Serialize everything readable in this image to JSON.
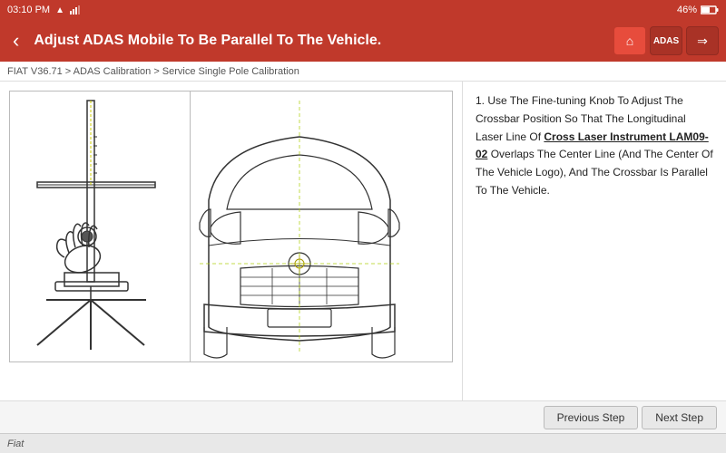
{
  "statusBar": {
    "time": "03:10 PM",
    "battery": "46%"
  },
  "header": {
    "title": "Adjust ADAS Mobile To Be Parallel To The Vehicle.",
    "backLabel": "‹"
  },
  "breadcrumb": {
    "text": "FIAT V36.71 > ADAS Calibration > Service Single Pole Calibration"
  },
  "instruction": {
    "step": "1.",
    "text1": " Use The Fine-tuning Knob To Adjust The Crossbar Position So That The Longitudinal Laser Line Of ",
    "highlight": "Cross Laser Instrument LAM09-02",
    "text2": " Overlaps The Center Line (And The Center Of The Vehicle Logo), And The Crossbar Is Parallel To The Vehicle."
  },
  "footer": {
    "previousStep": "Previous Step",
    "nextStep": "Next Step"
  },
  "brandBar": {
    "brand": "Fiat"
  },
  "icons": {
    "home": "⌂",
    "adas": "☰",
    "share": "→"
  }
}
